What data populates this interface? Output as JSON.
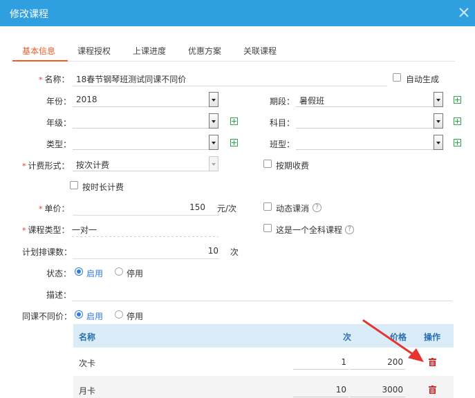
{
  "dialog": {
    "title": "修改课程"
  },
  "tabs": [
    {
      "label": "基本信息"
    },
    {
      "label": "课程授权"
    },
    {
      "label": "上课进度"
    },
    {
      "label": "优惠方案"
    },
    {
      "label": "关联课程"
    }
  ],
  "form": {
    "name": {
      "label": "名称：",
      "value": "18春节钢琴班测试同课不同价",
      "auto_generate_label": "自动生成"
    },
    "year": {
      "label": "年份：",
      "value": "2018"
    },
    "term": {
      "label": "期段：",
      "value": "暑假班"
    },
    "grade": {
      "label": "年级：",
      "value": ""
    },
    "subject": {
      "label": "科目：",
      "value": ""
    },
    "category": {
      "label": "类型：",
      "value": ""
    },
    "class_type": {
      "label": "班型：",
      "value": ""
    },
    "billing": {
      "label": "计费形式：",
      "value": "按次计费",
      "by_term_label": "按期收费",
      "by_hour_label": "按时长计费"
    },
    "price": {
      "label": "单价：",
      "value": "150",
      "unit": "元/次",
      "dynamic_cancel_label": "动态课消"
    },
    "course_type": {
      "label": "课程类型：",
      "value": "一对一",
      "full_subject_label": "这是一个全科课程"
    },
    "plan_count": {
      "label": "计划排课数：",
      "value": "10",
      "unit": "次"
    },
    "status": {
      "label": "状态：",
      "enabled": "启用",
      "disabled": "停用"
    },
    "description": {
      "label": "描述：",
      "value": ""
    },
    "diff_price": {
      "label": "同课不同价：",
      "enabled": "启用",
      "disabled": "停用"
    }
  },
  "price_table": {
    "headers": {
      "name": "名称",
      "count": "次",
      "price": "价格",
      "action": "操作"
    },
    "rows": [
      {
        "name": "次卡",
        "count": "1",
        "price": "200"
      },
      {
        "name": "月卡",
        "count": "10",
        "price": "3000"
      }
    ]
  },
  "colors": {
    "titlebar": "#2f9fe0",
    "active_tab": "#f05a2b",
    "radio_on": "#2f7be0",
    "add_icon": "#2aa84a",
    "delete_icon": "#d9232e",
    "table_header": "#d9ecf8"
  }
}
